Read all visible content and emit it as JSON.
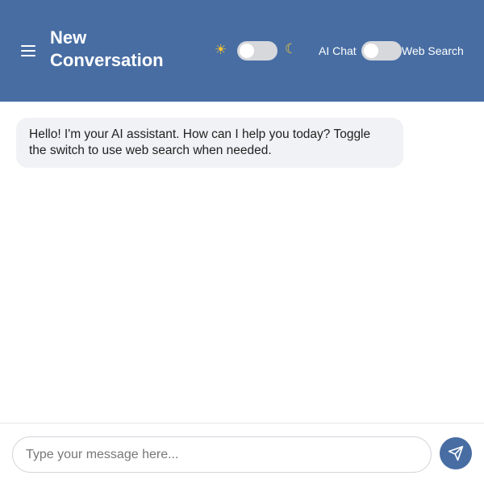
{
  "header": {
    "title": "New Conversation",
    "theme_toggle": {
      "left_icon": "sun-icon",
      "right_icon": "moon-icon",
      "checked": false
    },
    "mode_toggle": {
      "left_label": "AI Chat",
      "right_label": "Web Search",
      "checked": false
    }
  },
  "messages": [
    {
      "role": "assistant",
      "text": "Hello! I'm your AI assistant. How can I help you today? Toggle the switch to use web search when needed."
    }
  ],
  "composer": {
    "placeholder": "Type your message here...",
    "value": "",
    "send_icon": "send-icon"
  },
  "colors": {
    "header_bg": "#476da3",
    "bubble_bg": "#f1f2f5",
    "send_bg": "#476da3",
    "toggle_track": "#d6d8dc"
  }
}
